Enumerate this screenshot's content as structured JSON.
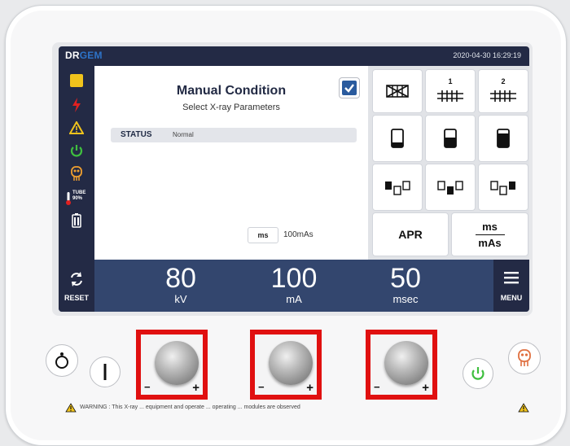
{
  "header": {
    "logo_dr": "DR",
    "logo_gem": "GEM",
    "datetime": "2020-04-30 16:29:19"
  },
  "sidebar": {
    "items": [
      {
        "icon": "yellow-square-icon",
        "color": "#f0c31c"
      },
      {
        "icon": "lightning-icon",
        "color": "#e02020"
      },
      {
        "icon": "warning-triangle-icon",
        "color": "#f0c31c"
      },
      {
        "icon": "power-icon",
        "color": "#3fbf3f"
      },
      {
        "icon": "tube-head-icon",
        "color": "#f0a030"
      },
      {
        "icon": "thermometer-icon",
        "label_line1": "TUBE",
        "label_line2": "90%"
      },
      {
        "icon": "battery-icon",
        "color": "#ffffff"
      }
    ]
  },
  "main": {
    "title": "Manual Condition",
    "subtitle": "Select X-ray Parameters",
    "checkbox_checked": true,
    "status_label": "STATUS",
    "status_value": "Normal",
    "ms_chip": "ms",
    "mas_value": "100mAs"
  },
  "tiles": {
    "apr_label": "APR",
    "ms_label": "ms",
    "mas_label": "mAs",
    "grid1_label": "1",
    "grid2_label": "2"
  },
  "bottombar": {
    "reset_label": "RESET",
    "menu_label": "MENU",
    "params": [
      {
        "value": "80",
        "unit": "kV"
      },
      {
        "value": "100",
        "unit": "mA"
      },
      {
        "value": "50",
        "unit": "msec"
      }
    ]
  },
  "hardware": {
    "knob_minus": "−",
    "knob_plus": "+",
    "warning_text": "WARNING : This X-ray ... equipment and operate ... operating ... modules are observed"
  },
  "colors": {
    "navy": "#232a45",
    "bar_blue": "#33466e",
    "highlight_red": "#e01010",
    "power_green": "#3fbf3f"
  }
}
